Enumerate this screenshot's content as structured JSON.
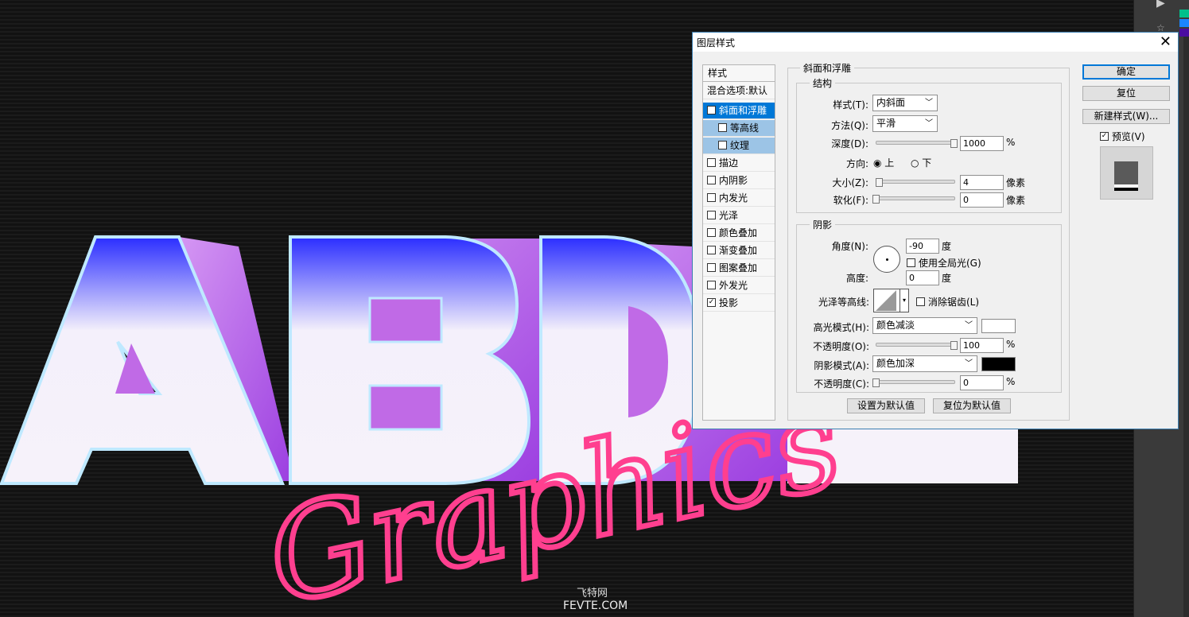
{
  "canvas": {
    "text_main": "ABD",
    "text_script": "Graphics",
    "watermark1": "飞特网",
    "watermark2": "FEVTE.COM"
  },
  "dialog": {
    "title": "图层样式",
    "styles_list": [
      {
        "label": "样式",
        "checkbox": false,
        "checked": false,
        "state": "header"
      },
      {
        "label": "混合选项:默认",
        "checkbox": false,
        "checked": false,
        "state": "normal"
      },
      {
        "label": "斜面和浮雕",
        "checkbox": true,
        "checked": true,
        "state": "selected"
      },
      {
        "label": "等高线",
        "checkbox": true,
        "checked": false,
        "state": "sub"
      },
      {
        "label": "纹理",
        "checkbox": true,
        "checked": false,
        "state": "sub"
      },
      {
        "label": "描边",
        "checkbox": true,
        "checked": false,
        "state": "normal"
      },
      {
        "label": "内阴影",
        "checkbox": true,
        "checked": false,
        "state": "normal"
      },
      {
        "label": "内发光",
        "checkbox": true,
        "checked": false,
        "state": "normal"
      },
      {
        "label": "光泽",
        "checkbox": true,
        "checked": false,
        "state": "normal"
      },
      {
        "label": "颜色叠加",
        "checkbox": true,
        "checked": false,
        "state": "normal"
      },
      {
        "label": "渐变叠加",
        "checkbox": true,
        "checked": false,
        "state": "normal"
      },
      {
        "label": "图案叠加",
        "checkbox": true,
        "checked": false,
        "state": "normal"
      },
      {
        "label": "外发光",
        "checkbox": true,
        "checked": false,
        "state": "normal"
      },
      {
        "label": "投影",
        "checkbox": true,
        "checked": true,
        "state": "normal"
      }
    ],
    "bevel": {
      "title": "斜面和浮雕",
      "structure": {
        "title": "结构",
        "style_label": "样式(T):",
        "style_value": "内斜面",
        "technique_label": "方法(Q):",
        "technique_value": "平滑",
        "depth_label": "深度(D):",
        "depth_value": "1000",
        "depth_unit": "%",
        "direction_label": "方向:",
        "dir_up": "上",
        "dir_down": "下",
        "size_label": "大小(Z):",
        "size_value": "4",
        "size_unit": "像素",
        "soften_label": "软化(F):",
        "soften_value": "0",
        "soften_unit": "像素"
      },
      "shading": {
        "title": "阴影",
        "angle_label": "角度(N):",
        "angle_value": "-90",
        "angle_unit": "度",
        "global_light_label": "使用全局光(G)",
        "altitude_label": "高度:",
        "altitude_value": "0",
        "altitude_unit": "度",
        "gloss_label": "光泽等高线:",
        "antialias_label": "消除锯齿(L)",
        "highlight_label": "高光模式(H):",
        "highlight_value": "颜色减淡",
        "highlight_color": "#ffffff",
        "hl_opacity_label": "不透明度(O):",
        "hl_opacity_value": "100",
        "hl_opacity_unit": "%",
        "shadow_label": "阴影模式(A):",
        "shadow_value": "颜色加深",
        "shadow_color": "#000000",
        "sh_opacity_label": "不透明度(C):",
        "sh_opacity_value": "0",
        "sh_opacity_unit": "%"
      },
      "make_default": "设置为默认值",
      "reset_default": "复位为默认值"
    },
    "buttons": {
      "ok": "确定",
      "reset": "复位",
      "new_style": "新建样式(W)...",
      "preview": "预览(V)"
    }
  }
}
